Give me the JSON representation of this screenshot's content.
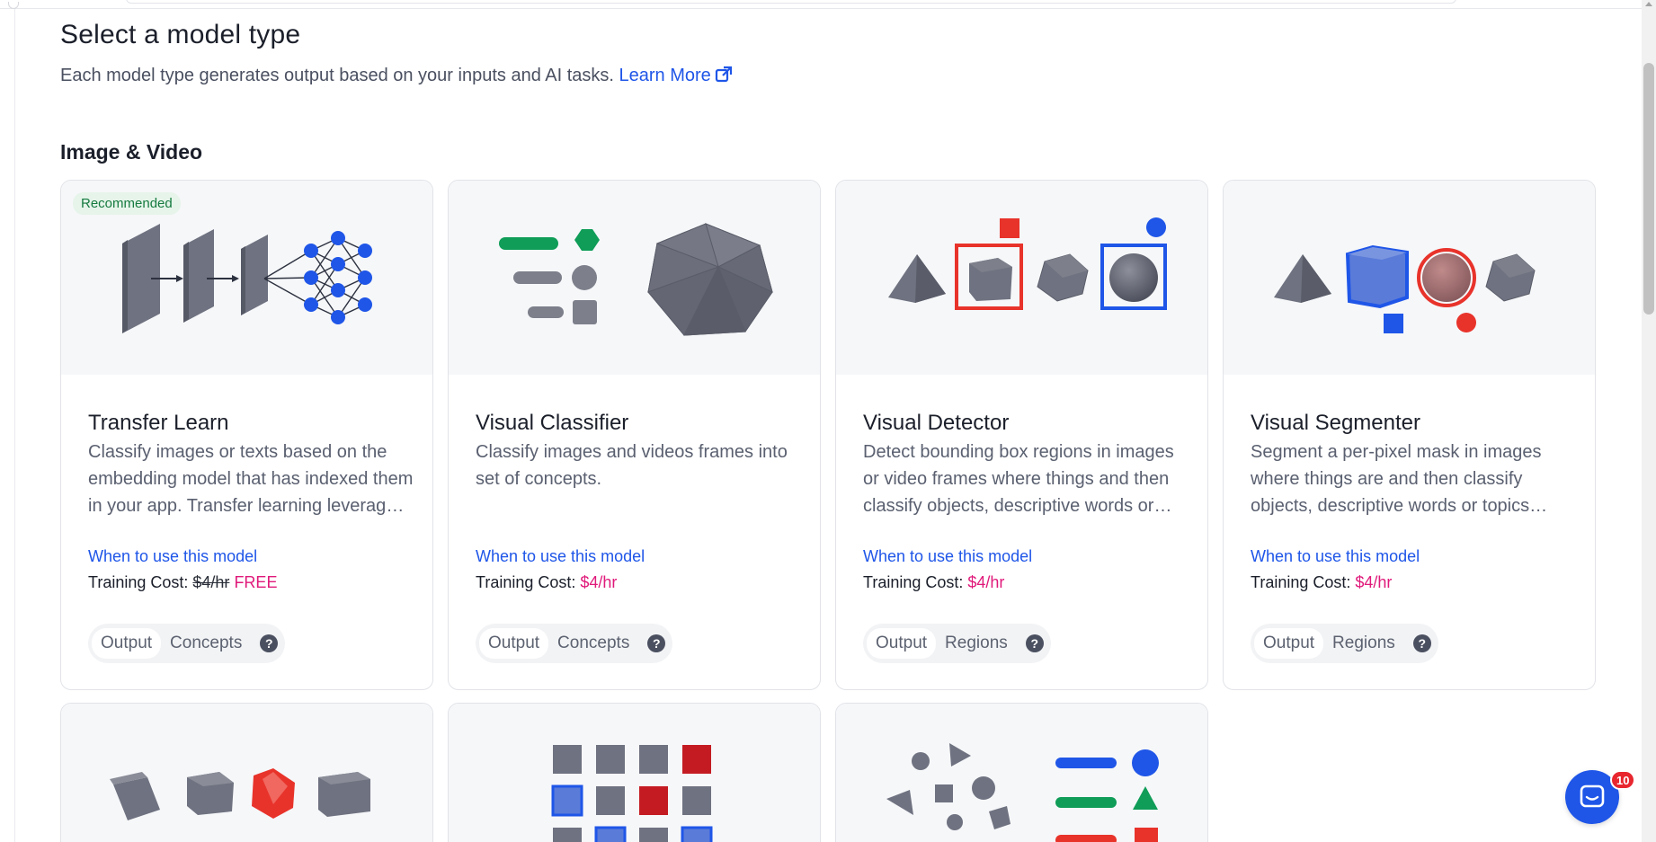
{
  "header": {
    "title": "Select a model type",
    "subtitle": "Each model type generates output based on your inputs and AI tasks.",
    "learn_more": "Learn More"
  },
  "section": {
    "title": "Image & Video"
  },
  "cards": [
    {
      "badge": "Recommended",
      "title": "Transfer Learn",
      "description": "Classify images or texts based on the embedding model that has indexed them in your app. Transfer learning leverages feature representations from a pre-trained model.",
      "when_link": "When to use this model",
      "cost_label": "Training Cost:",
      "cost_old": "$4/hr",
      "cost_new": "FREE",
      "output_label": "Output",
      "output_value": "Concepts",
      "help": "?"
    },
    {
      "title": "Visual Classifier",
      "description": "Classify images and videos frames into set of concepts.",
      "when_link": "When to use this model",
      "cost_label": "Training Cost:",
      "cost_new": "$4/hr",
      "output_label": "Output",
      "output_value": "Concepts",
      "help": "?"
    },
    {
      "title": "Visual Detector",
      "description": "Detect bounding box regions in images or video frames where things and then classify objects, descriptive words or topics within the boxes.",
      "when_link": "When to use this model",
      "cost_label": "Training Cost:",
      "cost_new": "$4/hr",
      "output_label": "Output",
      "output_value": "Regions",
      "help": "?"
    },
    {
      "title": "Visual Segmenter",
      "description": "Segment a per-pixel mask in images where things are and then classify objects, descriptive words or topics within the masks.",
      "when_link": "When to use this model",
      "cost_label": "Training Cost:",
      "cost_new": "$4/hr",
      "output_label": "Output",
      "output_value": "Regions",
      "help": "?"
    }
  ],
  "chat": {
    "badge_count": "10"
  },
  "colors": {
    "accent": "#1f56e8",
    "price": "#e0197a",
    "badge_green": "#157a3f",
    "shape_gray": "#6f7280",
    "red": "#e8332b",
    "green": "#0f9d58"
  }
}
